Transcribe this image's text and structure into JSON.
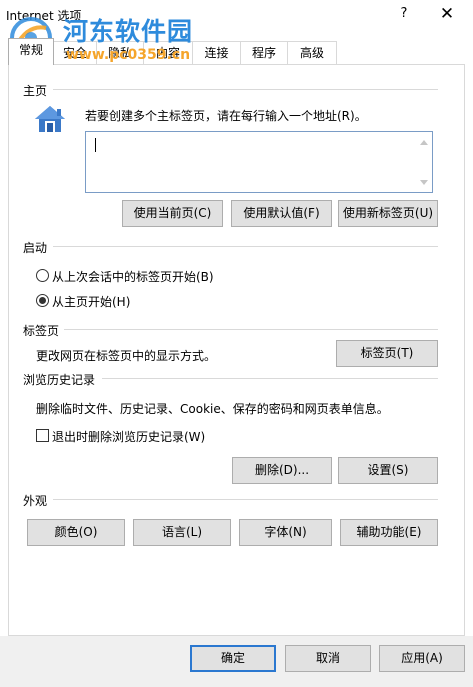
{
  "window": {
    "title": "Internet 选项",
    "help_glyph": "?",
    "close_glyph": "✕"
  },
  "watermark": {
    "brand": "河东软件园",
    "url": "www.pc0359.cn"
  },
  "tabs": [
    {
      "label": "常规"
    },
    {
      "label": "安全"
    },
    {
      "label": "隐私"
    },
    {
      "label": "内容"
    },
    {
      "label": "连接"
    },
    {
      "label": "程序"
    },
    {
      "label": "高级"
    }
  ],
  "home": {
    "heading": "主页",
    "instruction": "若要创建多个主标签页，请在每行输入一个地址(R)。",
    "textarea_value": "",
    "buttons": {
      "use_current": "使用当前页(C)",
      "use_default": "使用默认值(F)",
      "use_new_tab": "使用新标签页(U)"
    }
  },
  "startup": {
    "heading": "启动",
    "option_last_session": "从上次会话中的标签页开始(B)",
    "option_home": "从主页开始(H)",
    "selected": "home"
  },
  "tabsection": {
    "heading": "标签页",
    "description": "更改网页在标签页中的显示方式。",
    "button": "标签页(T)"
  },
  "history": {
    "heading": "浏览历史记录",
    "description": "删除临时文件、历史记录、Cookie、保存的密码和网页表单信息。",
    "checkbox_label": "退出时删除浏览历史记录(W)",
    "checkbox_checked": false,
    "delete_button": "删除(D)...",
    "settings_button": "设置(S)"
  },
  "appearance": {
    "heading": "外观",
    "colors": "颜色(O)",
    "languages": "语言(L)",
    "fonts": "字体(N)",
    "accessibility": "辅助功能(E)"
  },
  "footer": {
    "ok": "确定",
    "cancel": "取消",
    "apply": "应用(A)"
  },
  "colors": {
    "accent": "#2b78d0",
    "button_face": "#e1e1e1",
    "watermark_blue": "#2e8bdc",
    "watermark_orange": "#f5a52b"
  }
}
